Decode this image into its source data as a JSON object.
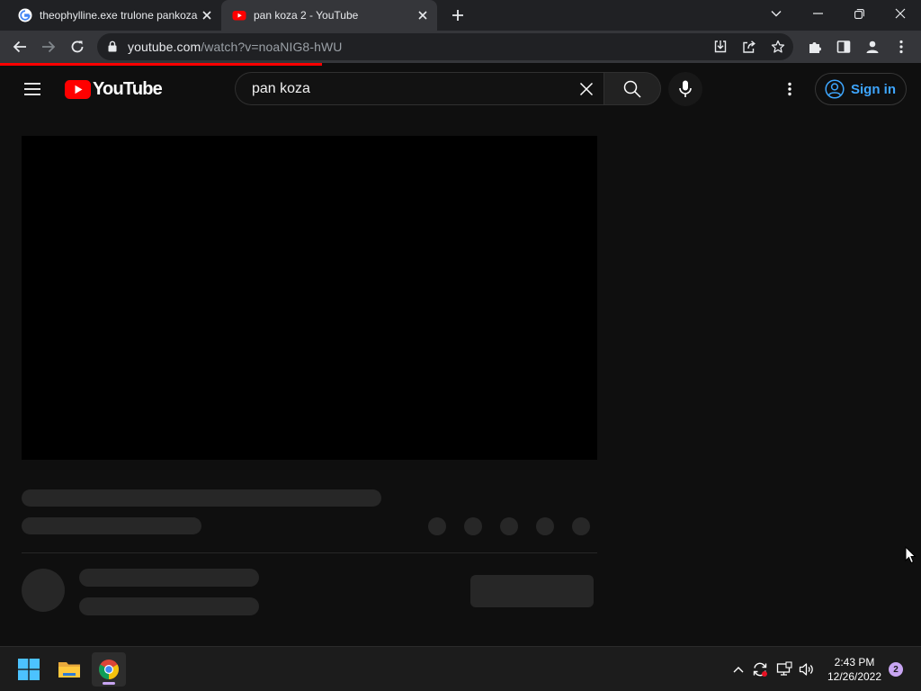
{
  "browser": {
    "tabs": [
      {
        "title": "theophylline.exe trulone pankoza",
        "active": false
      },
      {
        "title": "pan koza 2 - YouTube",
        "active": true
      }
    ],
    "url_host": "youtube.com",
    "url_path": "/watch?v=noaNIG8-hWU",
    "load_progress_percent": 35
  },
  "youtube": {
    "logo_text": "YouTube",
    "search": {
      "value": "pan koza"
    },
    "sign_in_label": "Sign in",
    "brand_red": "#ff0000",
    "link_blue": "#3ea6ff"
  },
  "taskbar": {
    "time": "2:43 PM",
    "date": "12/26/2022",
    "notification_count": "2"
  }
}
